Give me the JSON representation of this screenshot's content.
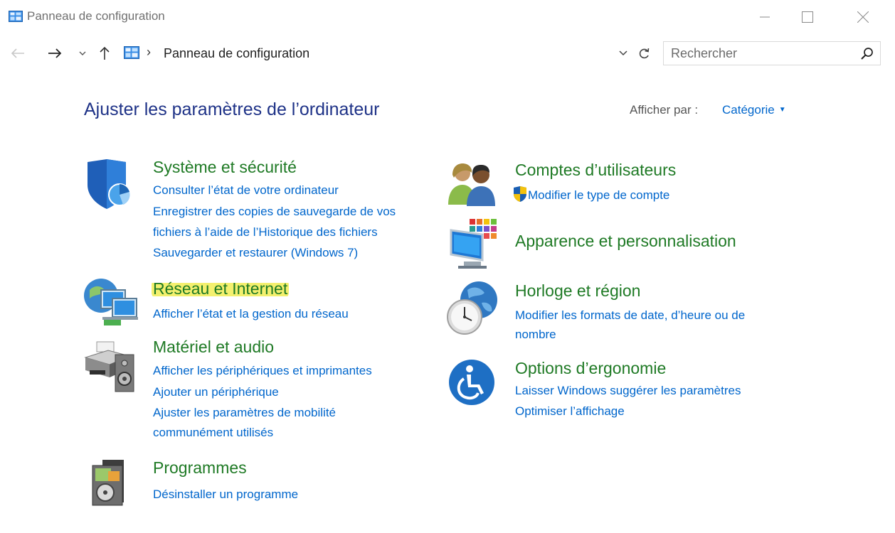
{
  "window": {
    "title": "Panneau de configuration"
  },
  "toolbar": {
    "back_icon": "arrow-left-icon",
    "forward_icon": "arrow-right-icon",
    "recent_icon": "chevron-down-icon",
    "up_icon": "arrow-up-icon",
    "address_separator": "›",
    "address_path": "Panneau de configuration",
    "search_placeholder": "Rechercher"
  },
  "header": {
    "title": "Ajuster les paramètres de l’ordinateur",
    "view_by_label": "Afficher par :",
    "view_by_value": "Catégorie"
  },
  "categories": {
    "system": {
      "title": "Système et sécurité",
      "links": [
        "Consulter l’état de votre ordinateur",
        "Enregistrer des copies de sauvegarde de vos",
        "fichiers à l’aide de l’Historique des fichiers",
        "Sauvegarder et restaurer (Windows 7)"
      ]
    },
    "network": {
      "title": "Réseau et Internet",
      "links": [
        "Afficher l’état et la gestion du réseau"
      ]
    },
    "hardware": {
      "title": "Matériel et audio",
      "links": [
        "Afficher les périphériques et imprimantes",
        "Ajouter un périphérique",
        "Ajuster les paramètres de mobilité",
        "communément utilisés"
      ]
    },
    "programs": {
      "title": "Programmes",
      "links": [
        "Désinstaller un programme"
      ]
    },
    "accounts": {
      "title": "Comptes d’utilisateurs",
      "links": [
        "Modifier le type de compte"
      ]
    },
    "appearance": {
      "title": "Apparence et personnalisation",
      "links": []
    },
    "clock": {
      "title": "Horloge et région",
      "links": [
        "Modifier les formats de date, d’heure ou de",
        "nombre"
      ]
    },
    "ease": {
      "title": "Options d’ergonomie",
      "links": [
        "Laisser Windows suggérer les paramètres",
        "Optimiser l’affichage"
      ]
    }
  },
  "colors": {
    "category_title": "#1f7a25",
    "link": "#0066cc",
    "page_title": "#1e3287",
    "highlight": "#f4f06e"
  }
}
